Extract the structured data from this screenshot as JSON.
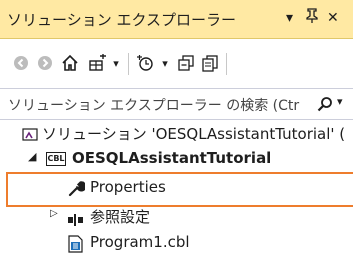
{
  "title_bar": {
    "title": "ソリューション エクスプローラー",
    "dropdown_glyph": "▾",
    "pin_glyph": "ᛘ",
    "close_glyph": "✕"
  },
  "toolbar": {
    "icons": [
      "back-icon",
      "forward-icon",
      "home-icon",
      "switch-views-icon",
      "dropdown-arrow-icon",
      "pending-changes-icon",
      "collapse-all-icon",
      "show-all-files-icon"
    ]
  },
  "search": {
    "placeholder": "ソリューション エクスプローラー の検索 (Ctr",
    "dropdown_glyph": "▾"
  },
  "tree": {
    "solution": "ソリューション 'OESQLAssistantTutorial' (",
    "project": "OESQLAssistantTutorial",
    "project_badge": "CBL",
    "properties": "Properties",
    "references": "参照設定",
    "program": "Program1.cbl"
  },
  "colors": {
    "title_bar_bg": "#ffe9a3",
    "highlight_border": "#ee7d2d",
    "icon_blue": "#1e6fb8"
  }
}
